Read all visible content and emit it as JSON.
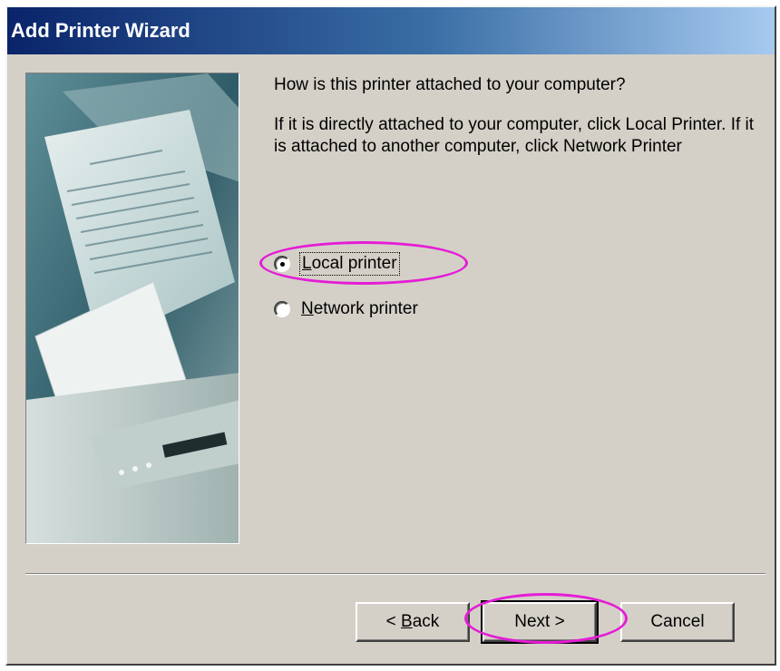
{
  "window": {
    "title": "Add Printer Wizard"
  },
  "main": {
    "question": "How is this printer attached to your computer?",
    "instructions": "If it is directly attached to your computer, click Local Printer. If it is attached to another computer, click Network Printer"
  },
  "options": {
    "local": {
      "label_mnemonic": "L",
      "label_rest": "ocal printer",
      "checked": true
    },
    "network": {
      "label_mnemonic": "N",
      "label_rest": "etwork printer",
      "checked": false
    }
  },
  "buttons": {
    "back": {
      "prefix": "< ",
      "mnemonic": "B",
      "rest": "ack"
    },
    "next": "Next >",
    "cancel": "Cancel"
  },
  "colors": {
    "highlight": "#e51cd6",
    "title_gradient_start": "#0a246a",
    "title_gradient_end": "#a6caf0",
    "face": "#d4d0c8"
  },
  "icons": [
    "printer-illustration"
  ]
}
